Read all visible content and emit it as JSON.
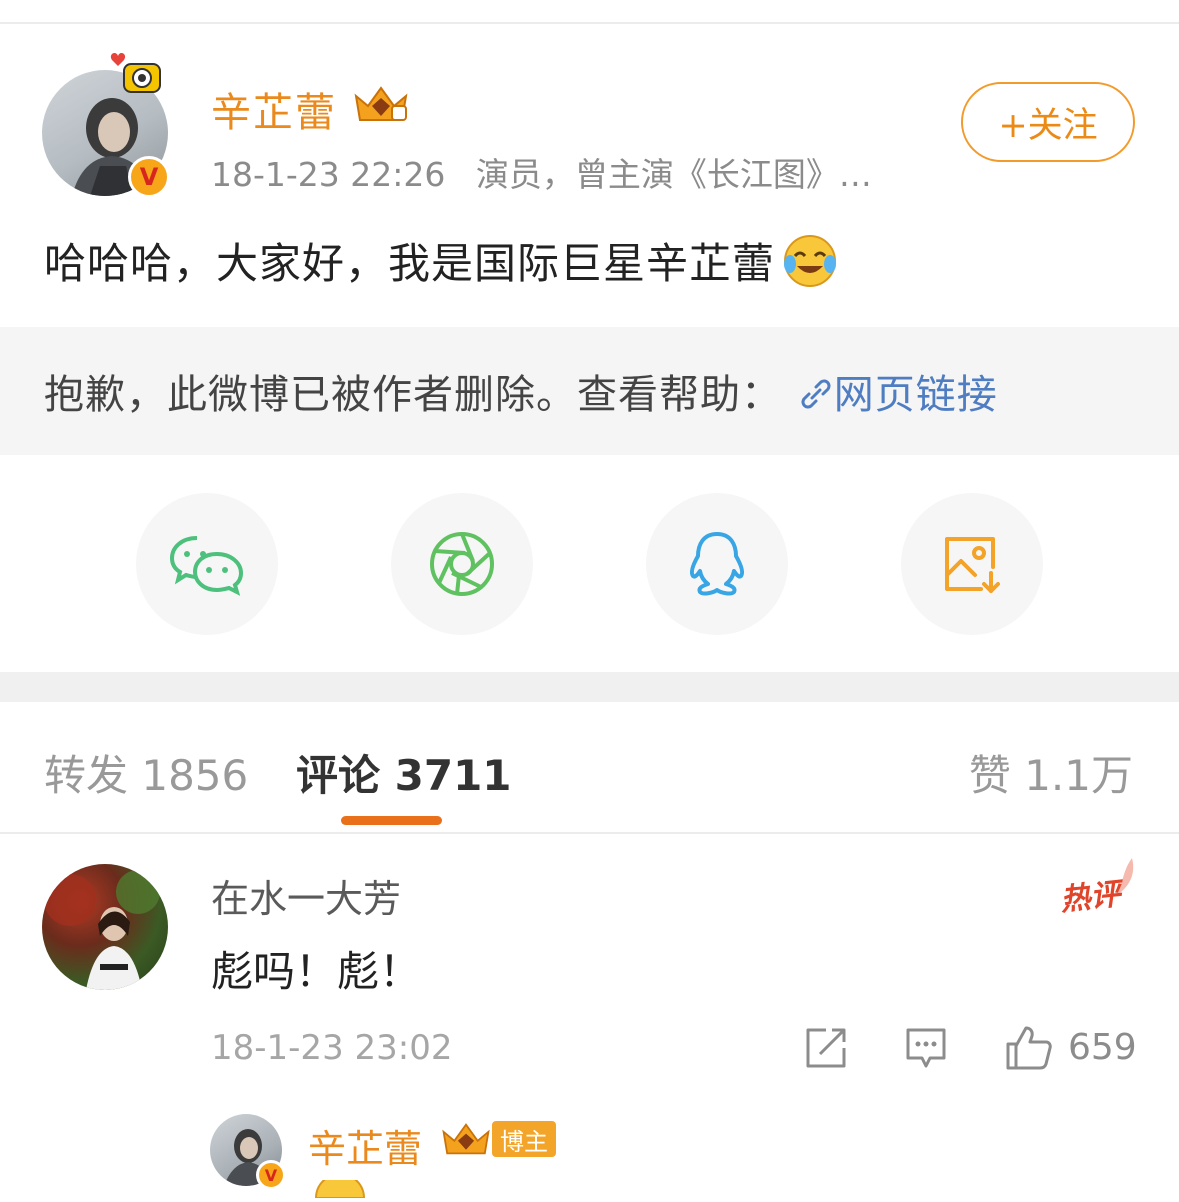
{
  "post": {
    "author": "辛芷蕾",
    "time": "18-1-23 22:26",
    "bio": "演员，曾主演《长江图》…",
    "follow_label": "+关注",
    "text": "哈哈哈，大家好，我是国际巨星辛芷蕾",
    "verified_mark": "V"
  },
  "deleted": {
    "message": "抱歉，此微博已被作者删除。查看帮助：",
    "link_label": "网页链接"
  },
  "share": {
    "items": [
      "wechat-icon",
      "moments-icon",
      "qq-icon",
      "save-image-icon"
    ]
  },
  "tabs": {
    "repost": "转发 1856",
    "comment": "评论 3711",
    "like": "赞 1.1万"
  },
  "comment": {
    "user": "在水一大芳",
    "text": "彪吗！彪！",
    "hot_badge": "热评",
    "time": "18-1-23 23:02",
    "likes": "659"
  },
  "reply": {
    "user": "辛芷蕾",
    "badge": "博主"
  },
  "colors": {
    "accent": "#ea8a1d",
    "link": "#4f7dc1",
    "wechat": "#4cc07c",
    "moments": "#5fc160",
    "qq": "#38a5e4",
    "save": "#f2a328",
    "hot": "#e0452b"
  }
}
